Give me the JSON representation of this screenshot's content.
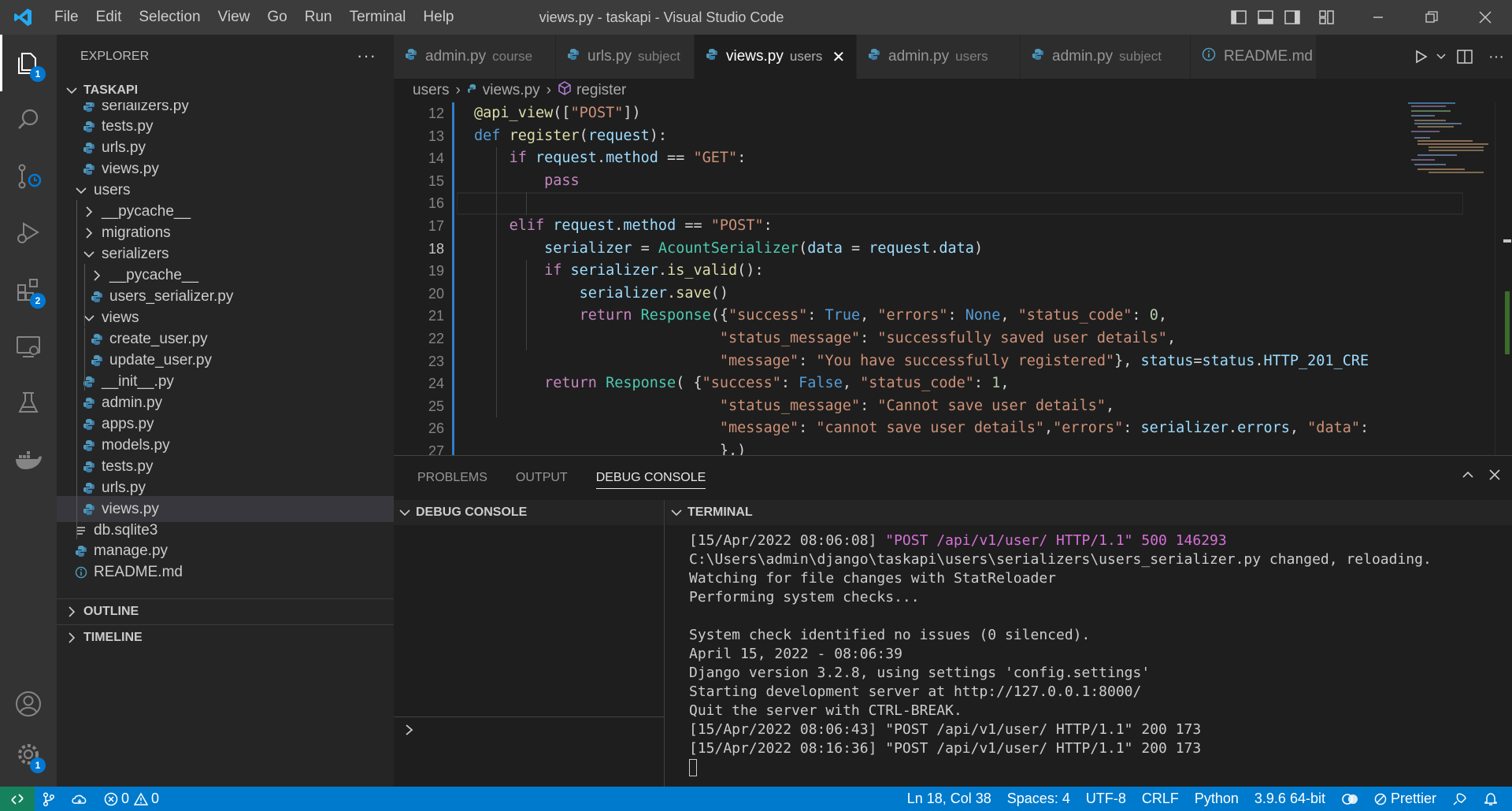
{
  "window": {
    "title": "views.py - taskapi - Visual Studio Code",
    "menu": [
      "File",
      "Edit",
      "Selection",
      "View",
      "Go",
      "Run",
      "Terminal",
      "Help"
    ]
  },
  "activity_bar": {
    "explorer_badge": "1",
    "extensions_badge": "2",
    "settings_badge": "1"
  },
  "sidebar": {
    "header": "EXPLORER",
    "more": "···",
    "project": "TASKAPI",
    "items": [
      {
        "label": "serializers.py",
        "icon": "python-file-icon"
      },
      {
        "label": "tests.py",
        "icon": "python-file-icon"
      },
      {
        "label": "urls.py",
        "icon": "python-file-icon"
      },
      {
        "label": "views.py",
        "icon": "python-file-icon"
      },
      {
        "label": "users",
        "icon": "chevron-down-icon"
      },
      {
        "label": "__pycache__",
        "icon": "chevron-right-icon"
      },
      {
        "label": "migrations",
        "icon": "chevron-right-icon"
      },
      {
        "label": "serializers",
        "icon": "chevron-down-icon"
      },
      {
        "label": "__pycache__",
        "icon": "chevron-right-icon"
      },
      {
        "label": "users_serializer.py",
        "icon": "python-file-icon"
      },
      {
        "label": "views",
        "icon": "chevron-down-icon"
      },
      {
        "label": "create_user.py",
        "icon": "python-file-icon"
      },
      {
        "label": "update_user.py",
        "icon": "python-file-icon"
      },
      {
        "label": "__init__.py",
        "icon": "python-file-icon"
      },
      {
        "label": "admin.py",
        "icon": "python-file-icon"
      },
      {
        "label": "apps.py",
        "icon": "python-file-icon"
      },
      {
        "label": "models.py",
        "icon": "python-file-icon"
      },
      {
        "label": "tests.py",
        "icon": "python-file-icon"
      },
      {
        "label": "urls.py",
        "icon": "python-file-icon"
      },
      {
        "label": "views.py",
        "icon": "python-file-icon"
      },
      {
        "label": "db.sqlite3",
        "icon": "lines-file-icon"
      },
      {
        "label": "manage.py",
        "icon": "python-file-icon"
      },
      {
        "label": "README.md",
        "icon": "info-icon"
      }
    ],
    "outline": "OUTLINE",
    "timeline": "TIMELINE"
  },
  "tabs": [
    {
      "name": "admin.py",
      "desc": "course"
    },
    {
      "name": "urls.py",
      "desc": "subject"
    },
    {
      "name": "views.py",
      "desc": "users",
      "active": true
    },
    {
      "name": "admin.py",
      "desc": "users"
    },
    {
      "name": "admin.py",
      "desc": "subject"
    },
    {
      "name": "README.md",
      "desc": ""
    }
  ],
  "breadcrumb": [
    "users",
    "views.py",
    "register"
  ],
  "code": {
    "line_numbers": [
      "12",
      "13",
      "14",
      "15",
      "16",
      "17",
      "18",
      "19",
      "20",
      "21",
      "22",
      "23",
      "24",
      "25",
      "26",
      "27"
    ],
    "current_line": "18"
  },
  "panel": {
    "tabs": [
      "PROBLEMS",
      "OUTPUT",
      "DEBUG CONSOLE"
    ],
    "active_tab": "DEBUG CONSOLE",
    "debug_header": "DEBUG CONSOLE",
    "terminal_header": "TERMINAL",
    "terminal_lines": [
      "[15/Apr/2022 08:06:08] ",
      "\"POST /api/v1/user/ HTTP/1.1\" 500 146293",
      "C:\\Users\\admin\\django\\taskapi\\users\\serializers\\users_serializer.py changed, reloading.",
      "Watching for file changes with StatReloader",
      "Performing system checks...",
      "",
      "System check identified no issues (0 silenced).",
      "April 15, 2022 - 08:06:39",
      "Django version 3.2.8, using settings 'config.settings'",
      "Starting development server at http://127.0.0.1:8000/",
      "Quit the server with CTRL-BREAK.",
      "[15/Apr/2022 08:06:43] \"POST /api/v1/user/ HTTP/1.1\" 200 173",
      "[15/Apr/2022 08:16:36] \"POST /api/v1/user/ HTTP/1.1\" 200 173"
    ]
  },
  "status": {
    "errors": "0",
    "warnings": "0",
    "position": "Ln 18, Col 38",
    "spaces": "Spaces: 4",
    "encoding": "UTF-8",
    "eol": "CRLF",
    "language": "Python",
    "interpreter": "3.9.6 64-bit",
    "prettier": "Prettier"
  },
  "colors": {
    "accent": "#007acc",
    "remote": "#16825d",
    "keyword": "#c586c0",
    "function": "#dcdcaa",
    "string": "#ce9178",
    "class": "#4ec9b0"
  }
}
